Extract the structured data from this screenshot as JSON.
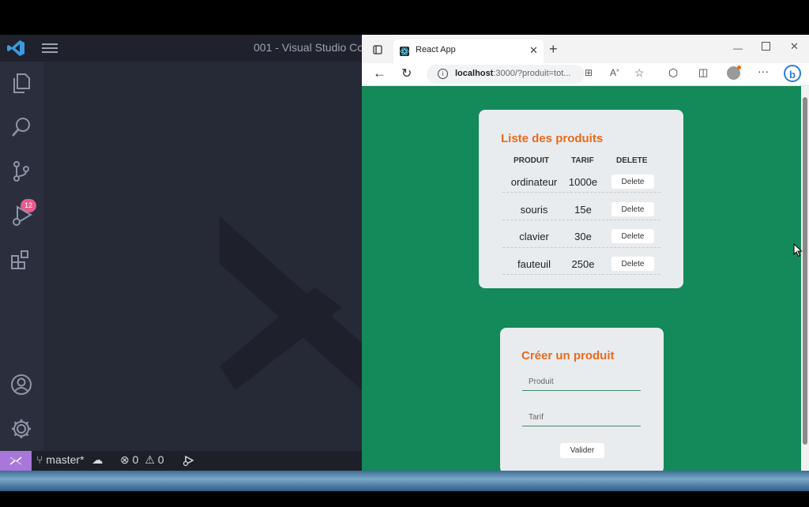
{
  "vscode": {
    "title": "001 - Visual Studio Co",
    "activity": {
      "icons": [
        "explorer-icon",
        "search-icon",
        "source-control-icon",
        "run-debug-icon",
        "extensions-icon",
        "account-icon",
        "gear-icon"
      ],
      "scm_badge": "12"
    },
    "status": {
      "branch": "master*",
      "errors": "0",
      "warnings": "0"
    }
  },
  "browser": {
    "tab_title": "React App",
    "tab_close": "✕",
    "new_tab": "+",
    "url": "localhost:3000/?produit=tot...",
    "url_host": "localhost",
    "url_rest": ":3000/?produit=tot..."
  },
  "products_card": {
    "title": "Liste des produits",
    "headers": [
      "PRODUIT",
      "TARIF",
      "DELETE"
    ],
    "rows": [
      {
        "produit": "ordinateur",
        "tarif": "1000e",
        "action": "Delete"
      },
      {
        "produit": "souris",
        "tarif": "15e",
        "action": "Delete"
      },
      {
        "produit": "clavier",
        "tarif": "30e",
        "action": "Delete"
      },
      {
        "produit": "fauteuil",
        "tarif": "250e",
        "action": "Delete"
      }
    ]
  },
  "create_card": {
    "title": "Créer un produit",
    "produit_placeholder": "Produit",
    "tarif_placeholder": "Tarif",
    "submit_label": "Valider"
  },
  "colors": {
    "page_bg": "#14895a",
    "accent_orange": "#e96a1b",
    "vscode_bg": "#262a36",
    "remote_purple": "#a877d9"
  }
}
